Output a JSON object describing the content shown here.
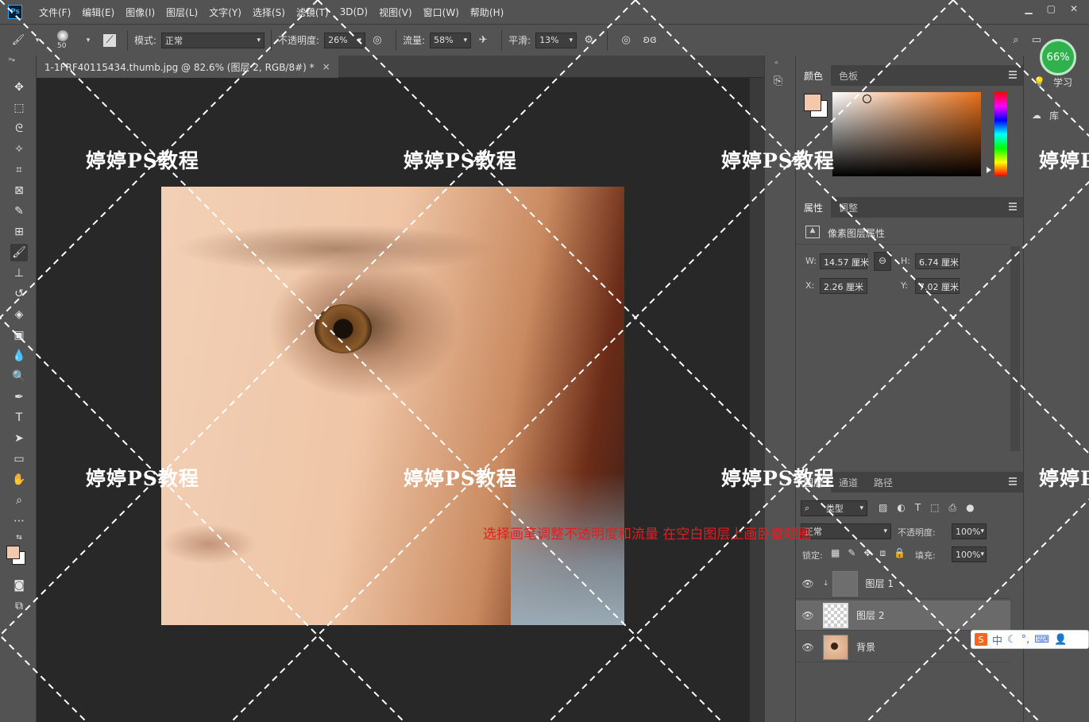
{
  "app": {
    "logo": "Ps"
  },
  "menu": [
    "文件(F)",
    "编辑(E)",
    "图像(I)",
    "图层(L)",
    "文字(Y)",
    "选择(S)",
    "滤镜(T)",
    "3D(D)",
    "视图(V)",
    "窗口(W)",
    "帮助(H)"
  ],
  "options": {
    "brush_size": "50",
    "mode_label": "模式:",
    "mode_value": "正常",
    "opacity_label": "不透明度:",
    "opacity_value": "26%",
    "flow_label": "流量:",
    "flow_value": "58%",
    "smooth_label": "平滑:",
    "smooth_value": "13%"
  },
  "document": {
    "tab_title": "1-1FRF40115434.thumb.jpg @ 82.6% (图层 2, RGB/8#) *",
    "close": "×"
  },
  "watermark": "婷婷PS教程",
  "instruction": "选择画笔调整不透明度和流量   在空白图层上画卧蚕眼圈",
  "color_panel": {
    "tabs": [
      "颜色",
      "色板"
    ],
    "foreground": "#f2c9ad",
    "background": "#ffffff"
  },
  "properties": {
    "tabs": [
      "属性",
      "调整"
    ],
    "section": "像素图层属性",
    "w_label": "W:",
    "w_value": "14.57 厘米",
    "h_label": "H:",
    "h_value": "6.74 厘米",
    "x_label": "X:",
    "x_value": "2.26 厘米",
    "y_label": "Y:",
    "y_value": "7.02 厘米"
  },
  "layers_panel": {
    "tabs": [
      "图层",
      "通道",
      "路径"
    ],
    "filter_value": "类型",
    "blend_value": "正常",
    "opacity_label": "不透明度:",
    "opacity_value": "100%",
    "lock_label": "锁定:",
    "fill_label": "填充:",
    "fill_value": "100%",
    "layers": [
      {
        "name": "图层 1",
        "selected": false
      },
      {
        "name": "图层 2",
        "selected": true
      },
      {
        "name": "背景",
        "selected": false
      }
    ]
  },
  "far_dock": {
    "learn": "学习",
    "library": "库"
  },
  "zoom_badge": "66%",
  "ime": {
    "lang": "中",
    "logo": "S"
  }
}
